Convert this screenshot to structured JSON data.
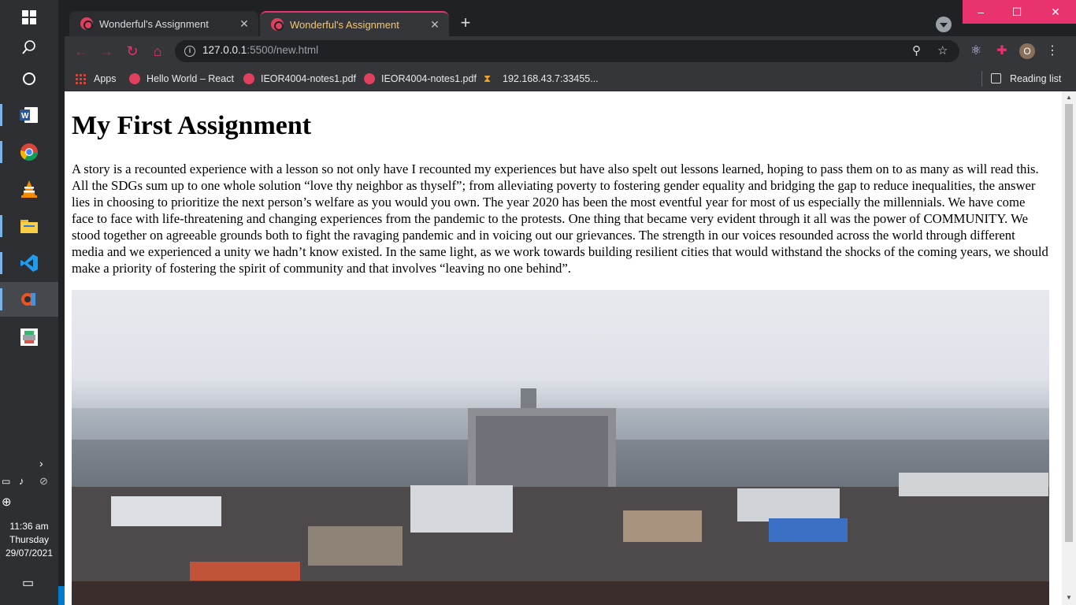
{
  "taskbar": {
    "apps": [
      "start",
      "search",
      "cortana",
      "word",
      "chrome",
      "vlc",
      "file-explorer",
      "vscode",
      "git-app",
      "generic-app"
    ],
    "clock": {
      "time": "11:36 am",
      "day": "Thursday",
      "date": "29/07/2021"
    }
  },
  "browser": {
    "tabs": [
      {
        "title": "Wonderful's Assignment",
        "active": false
      },
      {
        "title": "Wonderful's Assignment",
        "active": true
      }
    ],
    "url_host": "127.0.0.1",
    "url_rest": ":5500/new.html",
    "profile_initial": "O",
    "bookmarks": [
      {
        "label": "Apps",
        "icon": "apps-grid-icon"
      },
      {
        "label": "Hello World – React",
        "icon": "site-icon"
      },
      {
        "label": "IEOR4004-notes1.pdf",
        "icon": "site-icon"
      },
      {
        "label": "IEOR4004-notes1.pdf",
        "icon": "site-icon"
      },
      {
        "label": "192.168.43.7:33455...",
        "icon": "hourglass-icon"
      }
    ],
    "reading_list": "Reading list",
    "accent_color": "#e8336f"
  },
  "page": {
    "heading": "My First Assignment",
    "paragraph": "A story is a recounted experience with a lesson so not only have I recounted my experiences but have also spelt out lessons learned, hoping to pass them on to as many as will read this. All the SDGs sum up to one whole solution “love thy neighbor as thyself”; from alleviating poverty to fostering gender equality and bridging the gap to reduce inequalities, the answer lies in choosing to prioritize the next person’s welfare as you would you own. The year 2020 has been the most eventful year for most of us especially the millennials. We have come face to face with life-threatening and changing experiences from the pandemic to the protests. One thing that became very evident through it all was the power of COMMUNITY. We stood together on agreeable grounds both to fight the ravaging pandemic and in voicing out our grievances. The strength in our voices resounded across the world through different media and we experienced a unity we hadn’t know existed. In the same light, as we work towards building resilient cities that would withstand the shocks of the coming years, we should make a priority of fostering the spirit of community and that involves “leaving no one behind”."
  }
}
